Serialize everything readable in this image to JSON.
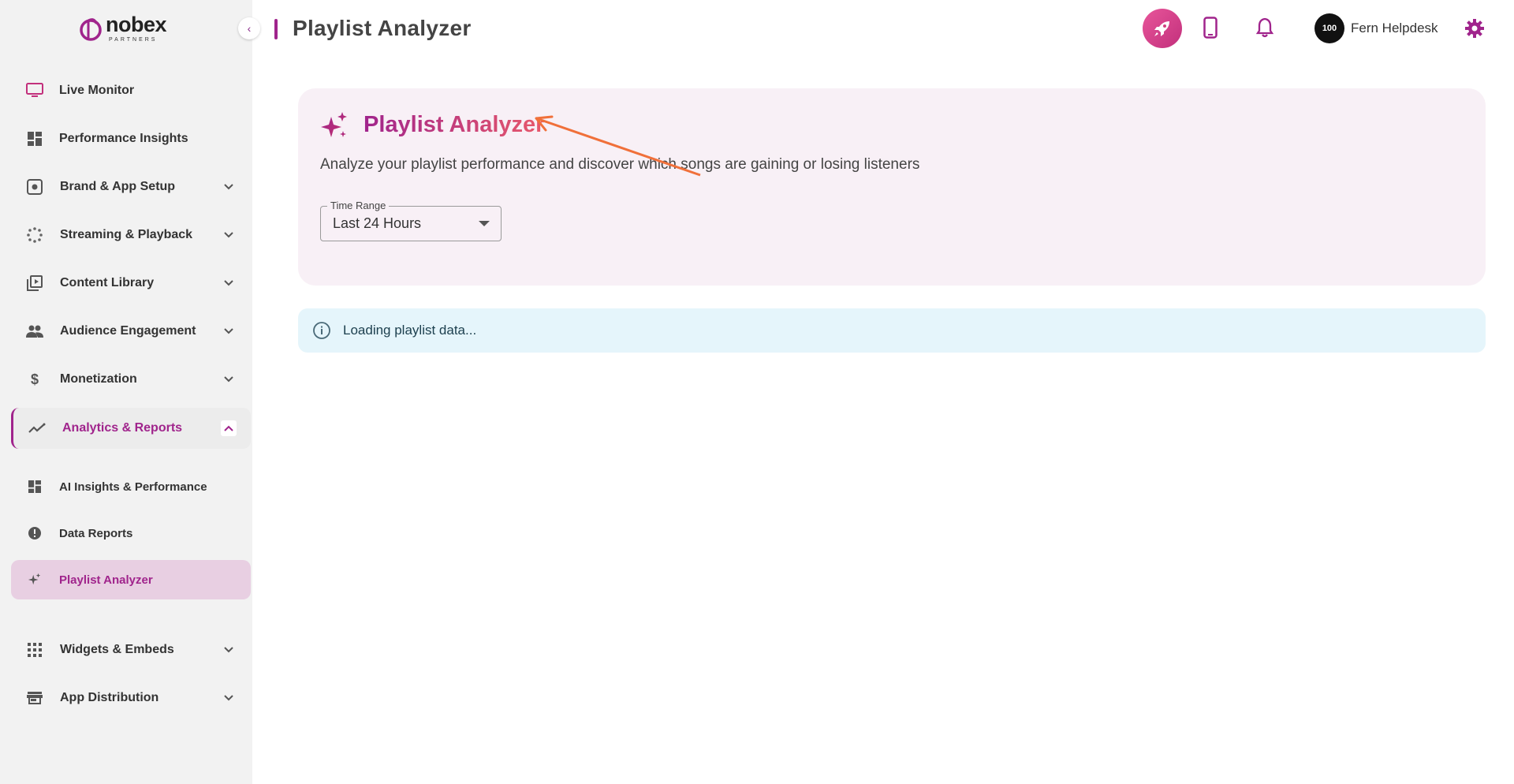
{
  "brand": {
    "name": "nobex",
    "tagline": "PARTNERS"
  },
  "sidebar": {
    "items": [
      {
        "label": "Live Monitor",
        "icon": "monitor-icon",
        "expandable": false
      },
      {
        "label": "Performance Insights",
        "icon": "dashboard-icon",
        "expandable": false
      },
      {
        "label": "Brand & App Setup",
        "icon": "settings-box-icon",
        "expandable": true
      },
      {
        "label": "Streaming & Playback",
        "icon": "spinner-icon",
        "expandable": true
      },
      {
        "label": "Content Library",
        "icon": "video-library-icon",
        "expandable": true
      },
      {
        "label": "Audience Engagement",
        "icon": "people-icon",
        "expandable": true
      },
      {
        "label": "Monetization",
        "icon": "dollar-icon",
        "expandable": true
      },
      {
        "label": "Analytics & Reports",
        "icon": "trending-icon",
        "expandable": true,
        "expanded": true
      },
      {
        "label": "Widgets & Embeds",
        "icon": "grid-icon",
        "expandable": true
      },
      {
        "label": "App Distribution",
        "icon": "store-icon",
        "expandable": true
      }
    ],
    "sub_items": [
      {
        "label": "AI Insights & Performance",
        "icon": "dashboard-icon"
      },
      {
        "label": "Data Reports",
        "icon": "alert-circle-icon"
      },
      {
        "label": "Playlist Analyzer",
        "icon": "sparkles-icon",
        "active": true
      }
    ]
  },
  "header": {
    "title": "Playlist Analyzer",
    "user_name": "Fern Helpdesk",
    "avatar_text": "100"
  },
  "main": {
    "card_title": "Playlist Analyzer",
    "card_description": "Analyze your playlist performance and discover which songs are gaining or losing listeners",
    "time_range": {
      "label": "Time Range",
      "value": "Last 24 Hours"
    },
    "alert_text": "Loading playlist data..."
  },
  "colors": {
    "accent": "#a0248c",
    "accent_pink": "#e8586a",
    "sidebar_bg": "#f2f2f2",
    "card_bg": "#f8f0f6",
    "alert_bg": "#e5f5fb",
    "annotation": "#f0703a"
  }
}
